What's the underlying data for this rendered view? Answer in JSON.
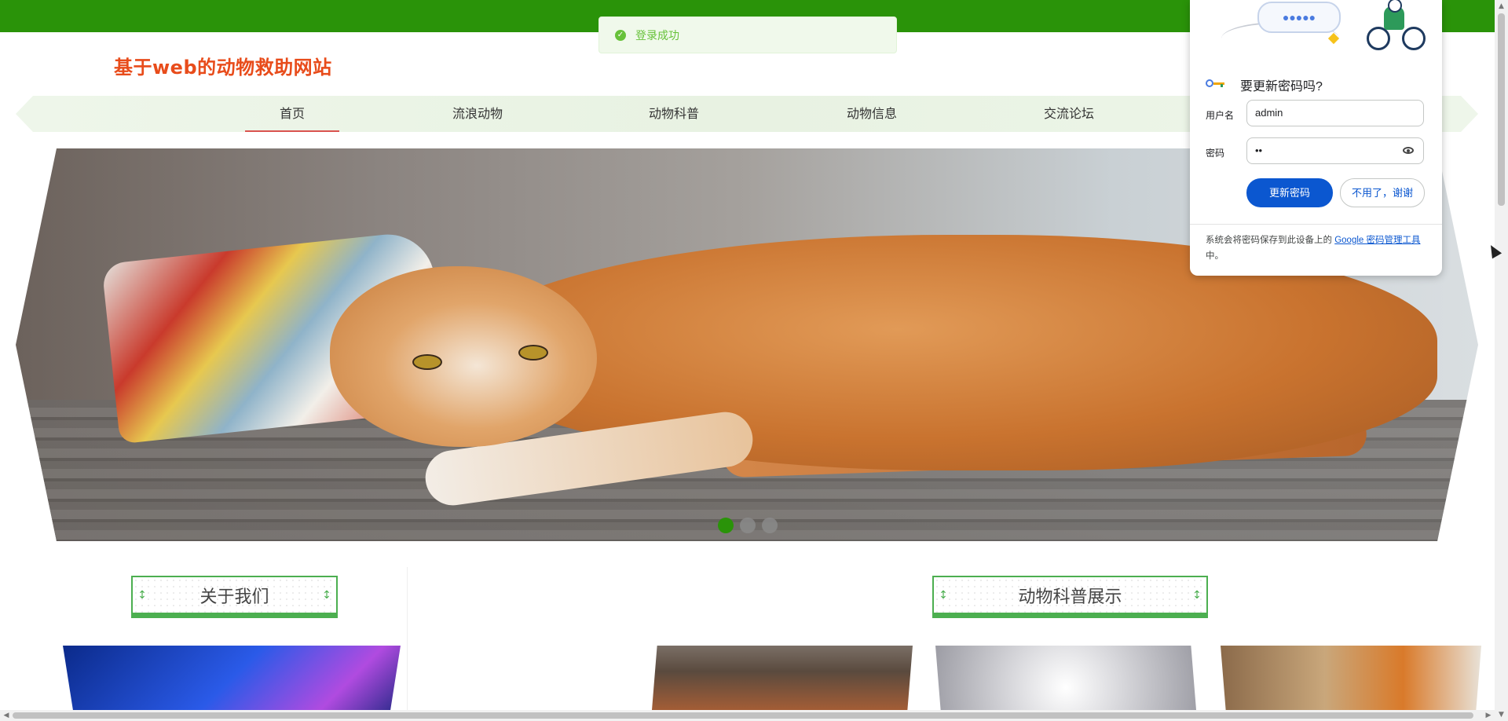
{
  "toast": {
    "message": "登录成功",
    "status_color": "#67c23a"
  },
  "site": {
    "title": "基于web的动物救助网站"
  },
  "nav": {
    "items": [
      {
        "label": "首页",
        "active": true
      },
      {
        "label": "流浪动物",
        "active": false
      },
      {
        "label": "动物科普",
        "active": false
      },
      {
        "label": "动物信息",
        "active": false
      },
      {
        "label": "交流论坛",
        "active": false
      }
    ]
  },
  "carousel": {
    "slides": 3,
    "active_index": 0
  },
  "sections": {
    "about_title": "关于我们",
    "science_title": "动物科普展示"
  },
  "password_popup": {
    "prompt": "要更新密码吗?",
    "username_label": "用户名",
    "username_value": "admin",
    "password_label": "密码",
    "password_value": "••",
    "update_button": "更新密码",
    "dismiss_button": "不用了，谢谢",
    "footer_text": "系统会将密码保存到此设备上的 ",
    "footer_link": "Google 密码管理工具",
    "footer_suffix": "中。",
    "bubble_dots": "●●●●●"
  },
  "colors": {
    "brand_green": "#2a9309",
    "title_red": "#e84c1b",
    "google_blue": "#0b57d0"
  }
}
